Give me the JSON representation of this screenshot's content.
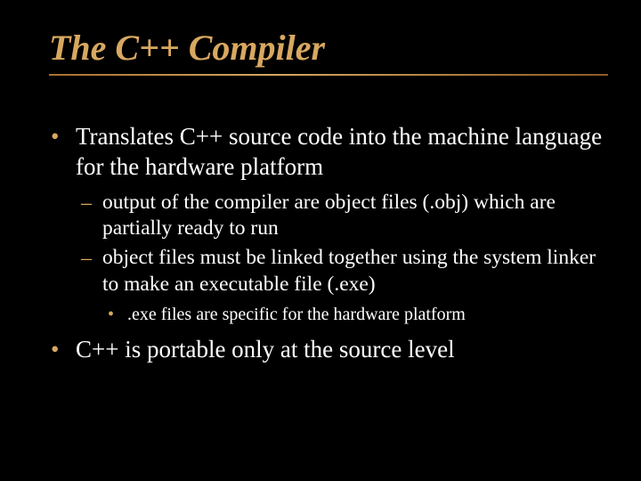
{
  "title": "The C++ Compiler",
  "bullets": {
    "b1": "Translates C++ source code into the machine language for the hardware platform",
    "b1_sub1": "output of the compiler are object files (.obj) which are partially ready to run",
    "b1_sub2": "object files must be linked together using the system linker to make an executable file (.exe)",
    "b1_sub2_sub1": ".exe files are specific for the hardware platform",
    "b2": "C++ is portable only at the source level"
  }
}
